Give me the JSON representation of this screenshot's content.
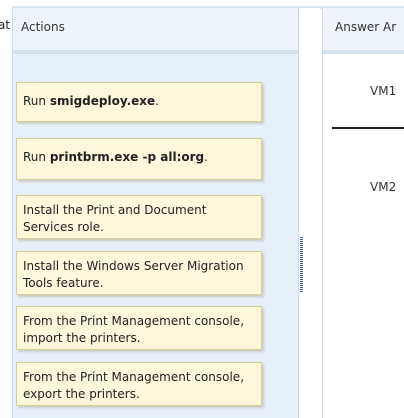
{
  "crop_fragment": "at",
  "actions": {
    "header": "Actions",
    "items": [
      {
        "prefix": "Run ",
        "command": "smigdeploy.exe",
        "suffix": ".",
        "text": ""
      },
      {
        "prefix": "Run ",
        "command": "printbrm.exe -p all:org",
        "suffix": ".",
        "text": ""
      },
      {
        "prefix": "",
        "command": "",
        "suffix": "",
        "text": "Install the Print and Document Services role."
      },
      {
        "prefix": "",
        "command": "",
        "suffix": "",
        "text": "Install the Windows Server Migration Tools feature."
      },
      {
        "prefix": "",
        "command": "",
        "suffix": "",
        "text": "From the Print Management console, import the printers."
      },
      {
        "prefix": "",
        "command": "",
        "suffix": "",
        "text": "From the Print Management console, export the printers."
      }
    ]
  },
  "answer_area": {
    "header": "Answer Ar",
    "slots": [
      {
        "label": "VM1"
      },
      {
        "label": "VM2"
      }
    ]
  }
}
